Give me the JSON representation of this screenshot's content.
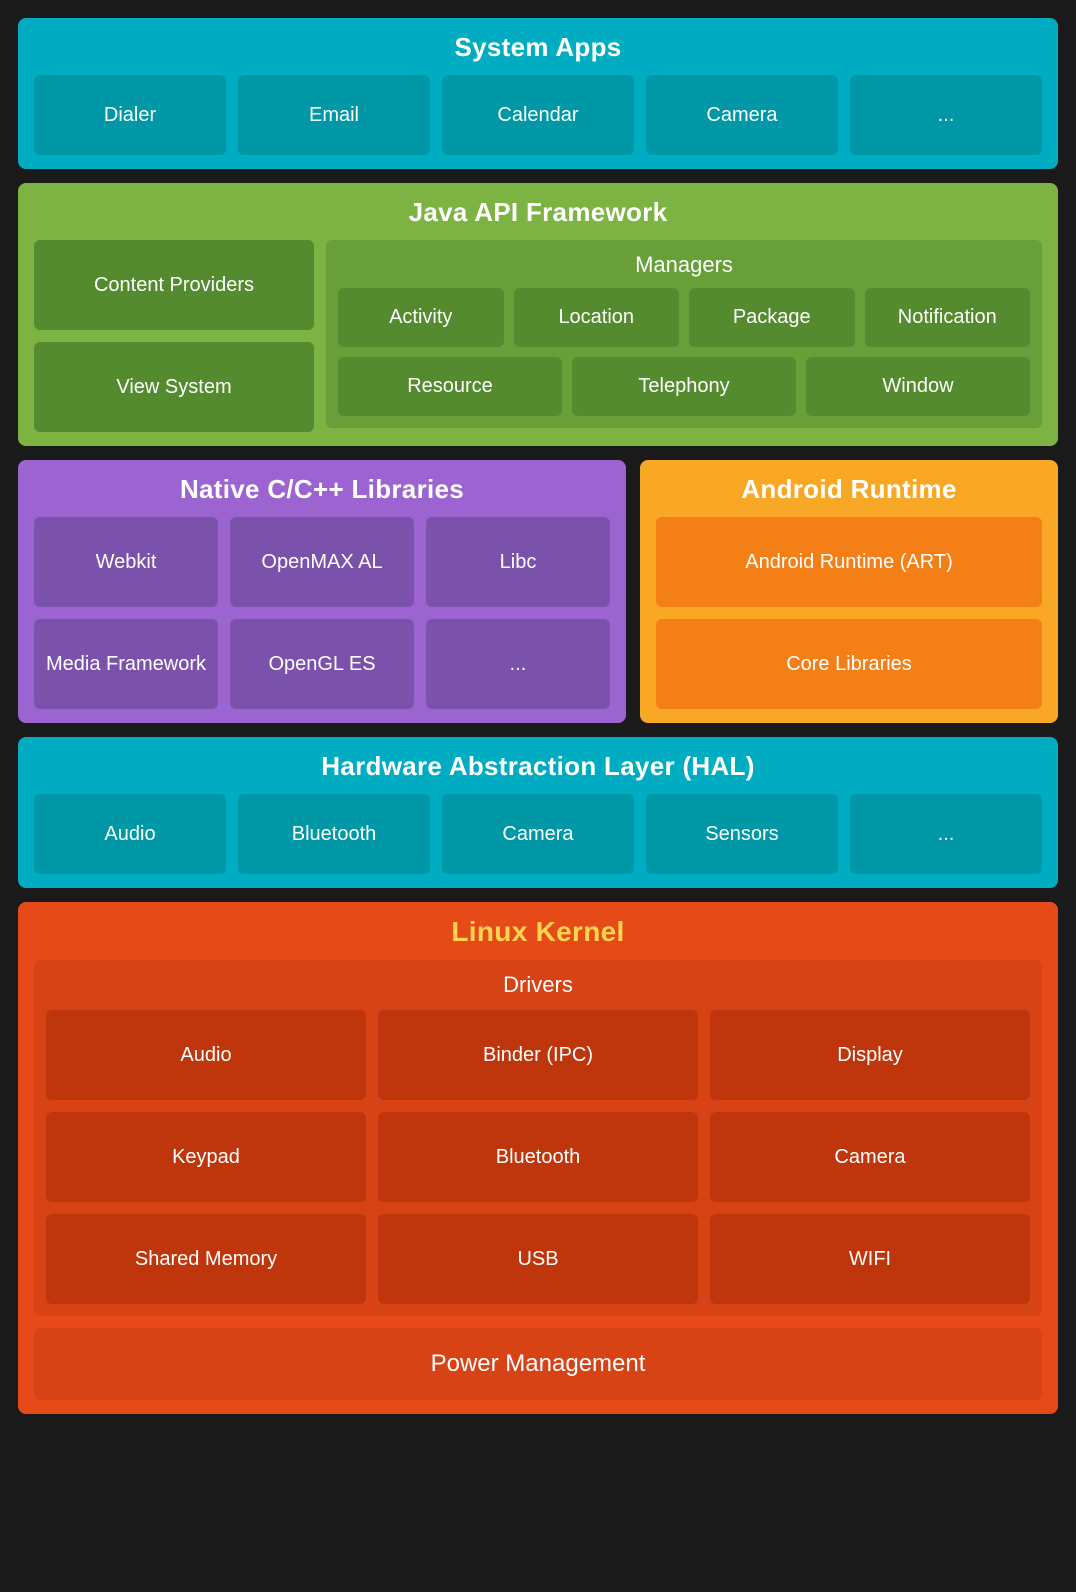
{
  "systemApps": {
    "title": "System Apps",
    "items": [
      "Dialer",
      "Email",
      "Calendar",
      "Camera",
      "..."
    ]
  },
  "javaAPI": {
    "title": "Java API Framework",
    "leftItems": [
      "Content Providers",
      "View System"
    ],
    "managers": {
      "title": "Managers",
      "row1": [
        "Activity",
        "Location",
        "Package",
        "Notification"
      ],
      "row2": [
        "Resource",
        "Telephony",
        "Window"
      ]
    }
  },
  "nativeLibs": {
    "title": "Native C/C++ Libraries",
    "items": [
      "Webkit",
      "OpenMAX AL",
      "Libc",
      "Media Framework",
      "OpenGL ES",
      "..."
    ]
  },
  "androidRuntime": {
    "title": "Android Runtime",
    "items": [
      "Android Runtime (ART)",
      "Core Libraries"
    ]
  },
  "hal": {
    "title": "Hardware Abstraction Layer (HAL)",
    "items": [
      "Audio",
      "Bluetooth",
      "Camera",
      "Sensors",
      "..."
    ]
  },
  "linuxKernel": {
    "title": "Linux Kernel",
    "drivers": {
      "title": "Drivers",
      "items": [
        "Audio",
        "Binder (IPC)",
        "Display",
        "Keypad",
        "Bluetooth",
        "Camera",
        "Shared Memory",
        "USB",
        "WIFI"
      ]
    },
    "powerManagement": "Power Management"
  }
}
